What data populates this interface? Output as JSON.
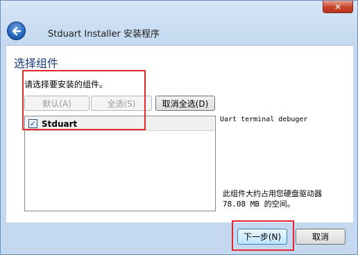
{
  "window": {
    "close_symbol": "✕",
    "title": "Stduart Installer 安装程序"
  },
  "page": {
    "title": "选择组件",
    "instruction": "请选择要安装的组件。"
  },
  "selection_buttons": {
    "default": "默认(A)",
    "select_all": "全选(S)",
    "deselect_all": "取消全选(D)"
  },
  "components": [
    {
      "label": "Stduart",
      "checked": true
    }
  ],
  "description": "Uart terminal debuger",
  "space_info": {
    "line1": "此组件大约占用您硬盘驱动器",
    "line2": "78.08 MB 的空间。"
  },
  "footer": {
    "next": "下一步(N)",
    "cancel": "取消"
  },
  "icons": {
    "back": "arrow-left-icon",
    "close": "close-icon",
    "checkbox": "checkmark-icon"
  },
  "colors": {
    "highlight": "#e3262b",
    "title_text": "#1a3a78"
  }
}
